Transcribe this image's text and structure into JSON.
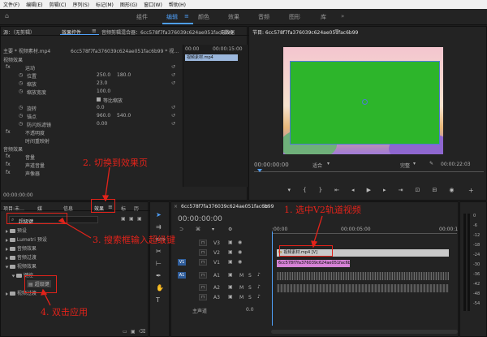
{
  "menubar": [
    "文件(F)",
    "编辑(E)",
    "剪辑(C)",
    "序列(S)",
    "标记(M)",
    "图形(G)",
    "窗口(W)",
    "帮助(H)"
  ],
  "workspaces": [
    "组件",
    "编辑",
    "颜色",
    "效果",
    "音频",
    "图形",
    "库"
  ],
  "source_panel": {
    "tabs": [
      "源：（无剪辑）",
      "效果控件",
      "音频剪辑混合器：6cc578f7fa376039c624ae051fac6b99",
      "元数据"
    ],
    "clip_master": "主要 * 视频素材.mp4",
    "clip_seq": "6cc578f7fa376039c624ae051fac6b99 * 视…",
    "section_video": "视频效果",
    "motion": "运动",
    "position_label": "位置",
    "position_x": "250.0",
    "position_y": "180.0",
    "scale_label": "缩放",
    "scale_value": "23.0",
    "scale_width_label": "缩放宽度",
    "scale_width_value": "100.0",
    "uniform_label": "等比缩放",
    "rotation_label": "旋转",
    "rotation_value": "0.0",
    "anchor_label": "锚点",
    "anchor_x": "960.0",
    "anchor_y": "540.0",
    "flicker_label": "防闪烁滤镜",
    "flicker_value": "0.00",
    "opacity_label": "不透明度",
    "remap_label": "时间重映射",
    "section_audio": "音频效果",
    "volume_label": "音量",
    "channel_label": "声道音量",
    "panner_label": "声像器",
    "mini_clip": "视频素材.mp4",
    "mini_time_start": "00:00",
    "mini_time_end": "00:00:15:00",
    "footer_time": "00:00:00:00"
  },
  "program": {
    "title": "节目: 6cc578f7fa376039c624ae051fac6b99",
    "timecode": "00:00:00:00",
    "fit": "适合",
    "quality": "完整",
    "duration": "00:00:22:03"
  },
  "effects_panel": {
    "tabs": [
      "项目:未…",
      "媒",
      "信息",
      "效果",
      "标",
      "历"
    ],
    "search_value": "超级键",
    "tree": [
      "预设",
      "Lumetri 预设",
      "音频效果",
      "音频过渡",
      "视频效果",
      "键控",
      "超级键",
      "视频过渡"
    ]
  },
  "timeline": {
    "title": "6cc578f7fa376039c624ae051fac6b99",
    "timecode": "00:00:00:00",
    "ruler_left": ":00:00",
    "ruler_mid": "00:00:05:00",
    "ruler_right": "00:00:1",
    "tracks": [
      "V3",
      "V2",
      "V1",
      "A1",
      "A2",
      "A3"
    ],
    "target_v": "V1",
    "target_a": "A1",
    "clip_v2": "视频素材.mp4 [V]",
    "clip_v1": "6cc578f7fa376039c624ae051fac6b99.jpg",
    "master": "主声道",
    "master_value": "0.0",
    "m": "M",
    "s": "S"
  },
  "meter": [
    "0",
    "-6",
    "-12",
    "-18",
    "-24",
    "-30",
    "-36",
    "-42",
    "-48",
    "-54"
  ],
  "annotations": {
    "a1": "1. 选中V2轨道视频",
    "a2": "2. 切换到效果页",
    "a3": "3. 搜索框输入超级键",
    "a4": "4. 双击应用"
  },
  "colors": {
    "accent": "#4f9ff7",
    "annotation": "#e2231a",
    "green_screen": "#2db52b",
    "clip_v2": "#c9c9c9",
    "clip_v1": "#d682d6"
  }
}
